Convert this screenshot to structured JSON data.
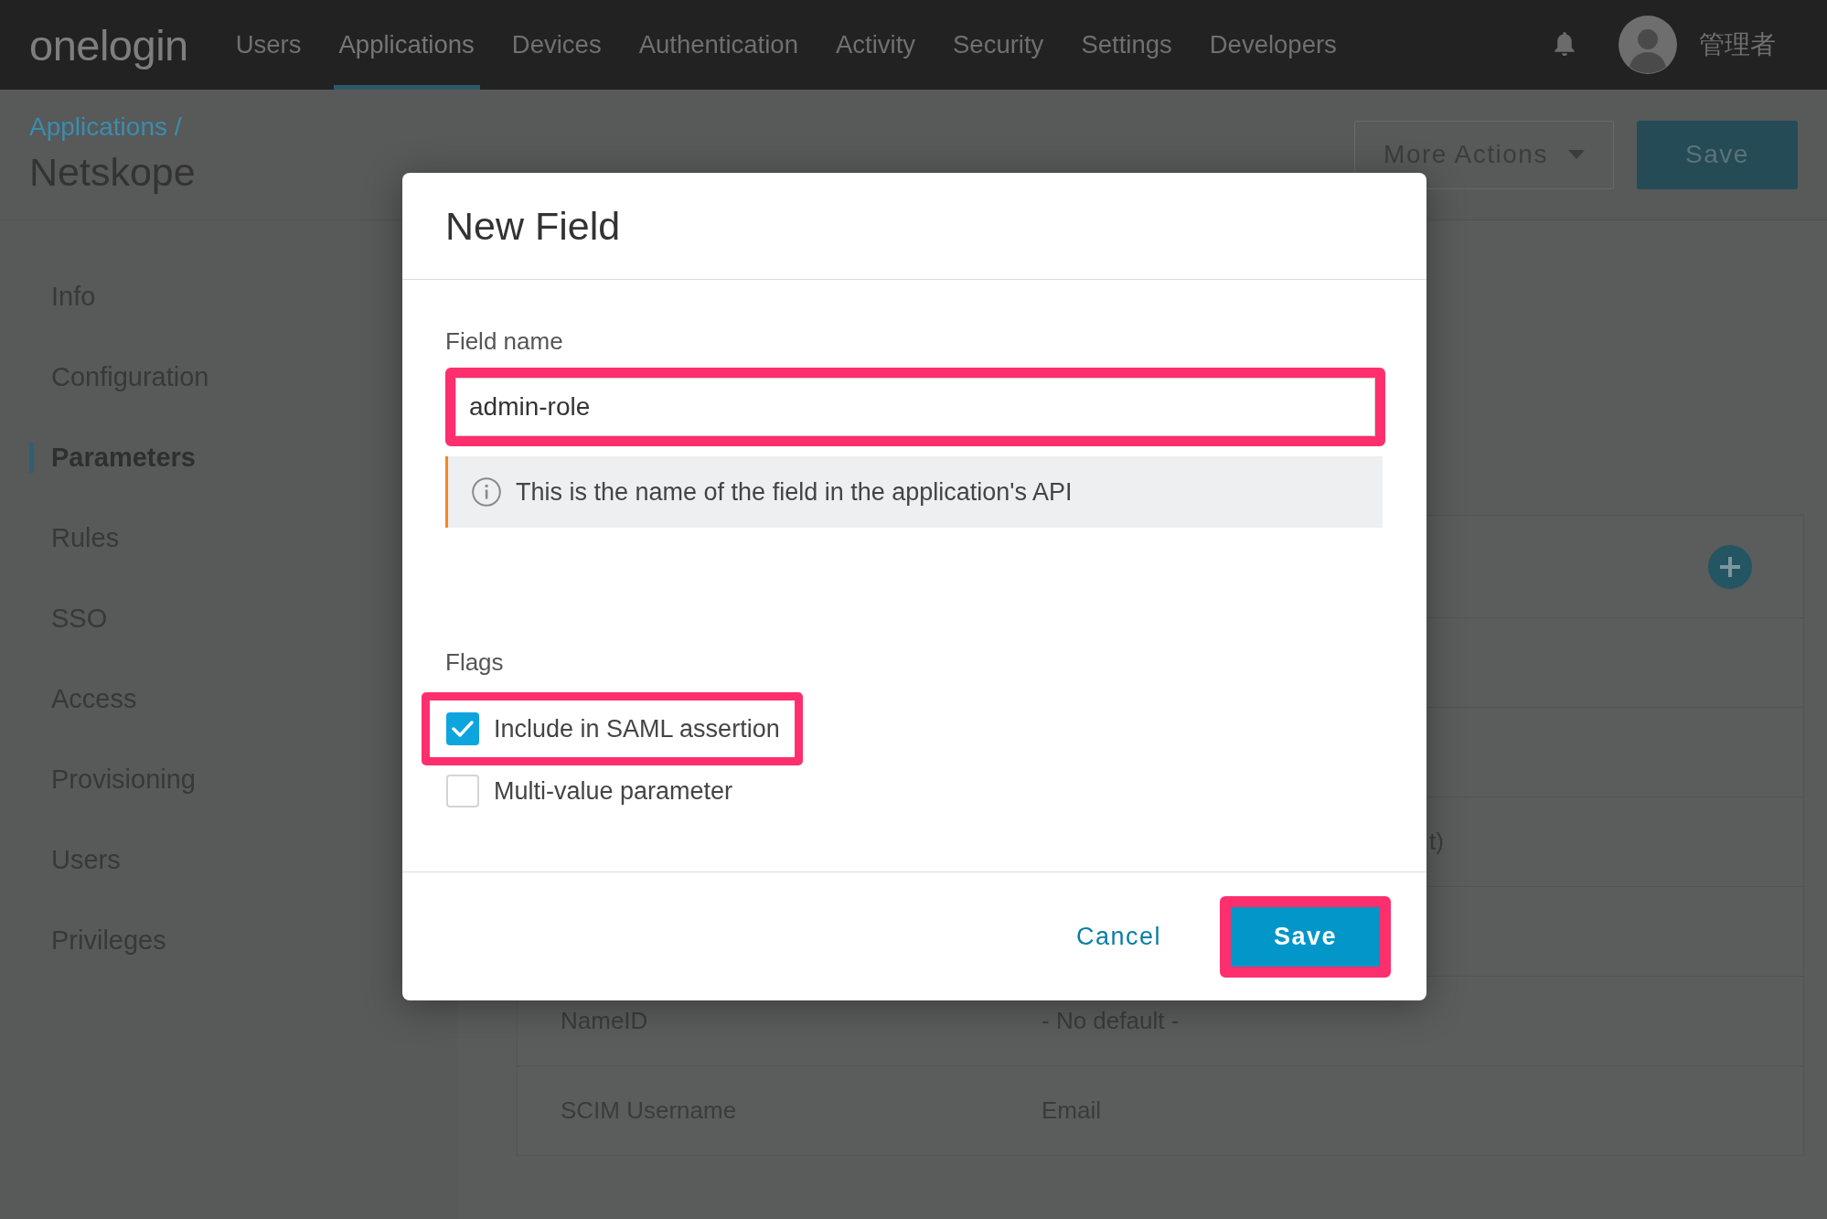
{
  "top_nav": {
    "logo": "onelogin",
    "items": [
      {
        "label": "Users",
        "selected": false
      },
      {
        "label": "Applications",
        "selected": true
      },
      {
        "label": "Devices",
        "selected": false
      },
      {
        "label": "Authentication",
        "selected": false
      },
      {
        "label": "Activity",
        "selected": false
      },
      {
        "label": "Security",
        "selected": false
      },
      {
        "label": "Settings",
        "selected": false
      },
      {
        "label": "Developers",
        "selected": false
      }
    ],
    "user_name": "管理者"
  },
  "page_header": {
    "breadcrumb": "Applications /",
    "title": "Netskope",
    "buttons": [
      {
        "label": "More Actions",
        "kind": "dropdown"
      },
      {
        "label": "Save",
        "kind": "primary"
      }
    ]
  },
  "sidebar": {
    "items": [
      {
        "label": "Info",
        "selected": false
      },
      {
        "label": "Configuration",
        "selected": false
      },
      {
        "label": "Parameters",
        "selected": true
      },
      {
        "label": "Rules",
        "selected": false
      },
      {
        "label": "SSO",
        "selected": false
      },
      {
        "label": "Access",
        "selected": false
      },
      {
        "label": "Provisioning",
        "selected": false
      },
      {
        "label": "Users",
        "selected": false
      },
      {
        "label": "Privileges",
        "selected": false
      }
    ]
  },
  "parameters_table": {
    "rows": [
      {
        "kind": "covered"
      },
      {
        "kind": "covered"
      },
      {
        "kind": "covered",
        "column_2": "t)"
      },
      {
        "kind": "covered"
      },
      {
        "kind": "plain",
        "column_1": "NameID",
        "column_2": "- No default -"
      },
      {
        "kind": "plain",
        "column_1": "SCIM Username",
        "column_2": "Email"
      }
    ]
  },
  "dialog": {
    "title": "New Field",
    "field": {
      "label": "Field name",
      "value": "admin-role",
      "highlighted": true
    },
    "hint": "This is the name of the field in the application's API",
    "flags": {
      "label": "Flags",
      "options": [
        {
          "label": "Include in SAML assertion",
          "checked": true,
          "highlighted": true
        },
        {
          "label": "Multi-value parameter",
          "checked": false,
          "highlighted": false
        }
      ]
    },
    "buttons": [
      {
        "label": "Cancel",
        "kind": "link",
        "highlighted": false
      },
      {
        "label": "Save",
        "kind": "primary",
        "highlighted": true
      }
    ]
  }
}
